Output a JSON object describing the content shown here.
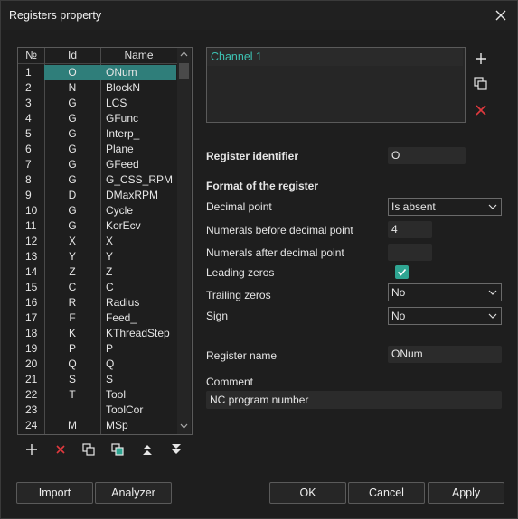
{
  "window": {
    "title": "Registers property"
  },
  "table": {
    "headers": {
      "num": "№",
      "id": "Id",
      "name": "Name"
    },
    "selected_index": 0,
    "rows": [
      {
        "num": "1",
        "id": "O",
        "name": "ONum"
      },
      {
        "num": "2",
        "id": "N",
        "name": "BlockN"
      },
      {
        "num": "3",
        "id": "G",
        "name": "LCS"
      },
      {
        "num": "4",
        "id": "G",
        "name": "GFunc"
      },
      {
        "num": "5",
        "id": "G",
        "name": "Interp_"
      },
      {
        "num": "6",
        "id": "G",
        "name": "Plane"
      },
      {
        "num": "7",
        "id": "G",
        "name": "GFeed"
      },
      {
        "num": "8",
        "id": "G",
        "name": "G_CSS_RPM"
      },
      {
        "num": "9",
        "id": "D",
        "name": "DMaxRPM"
      },
      {
        "num": "10",
        "id": "G",
        "name": "Cycle"
      },
      {
        "num": "11",
        "id": "G",
        "name": "KorEcv"
      },
      {
        "num": "12",
        "id": "X",
        "name": "X"
      },
      {
        "num": "13",
        "id": "Y",
        "name": "Y"
      },
      {
        "num": "14",
        "id": "Z",
        "name": "Z"
      },
      {
        "num": "15",
        "id": "C",
        "name": "C"
      },
      {
        "num": "16",
        "id": "R",
        "name": "Radius"
      },
      {
        "num": "17",
        "id": "F",
        "name": "Feed_"
      },
      {
        "num": "18",
        "id": "K",
        "name": "KThreadStep"
      },
      {
        "num": "19",
        "id": "P",
        "name": "P"
      },
      {
        "num": "20",
        "id": "Q",
        "name": "Q"
      },
      {
        "num": "21",
        "id": "S",
        "name": "S"
      },
      {
        "num": "22",
        "id": "T",
        "name": "Tool"
      },
      {
        "num": "23",
        "id": "",
        "name": "ToolCor"
      },
      {
        "num": "24",
        "id": "M",
        "name": "MSp"
      }
    ]
  },
  "channels": {
    "items": [
      "Channel 1"
    ]
  },
  "form": {
    "register_identifier_label": "Register identifier",
    "register_identifier_value": "O",
    "format_heading": "Format of the register",
    "decimal_point_label": "Decimal point",
    "decimal_point_value": "Is absent",
    "numerals_before_label": "Numerals before decimal point",
    "numerals_before_value": "4",
    "numerals_after_label": "Numerals after decimal point",
    "numerals_after_value": "",
    "leading_zeros_label": "Leading zeros",
    "leading_zeros_checked": true,
    "trailing_zeros_label": "Trailing zeros",
    "trailing_zeros_value": "No",
    "sign_label": "Sign",
    "sign_value": "No",
    "register_name_label": "Register name",
    "register_name_value": "ONum",
    "comment_label": "Comment",
    "comment_value": "NC program number"
  },
  "buttons": {
    "import": "Import",
    "analyzer": "Analyzer",
    "ok": "OK",
    "cancel": "Cancel",
    "apply": "Apply"
  },
  "colors": {
    "accent": "#3dc1b2",
    "selection": "#2f7e7a",
    "delete_red": "#e0393e",
    "check": "#2fa592"
  }
}
